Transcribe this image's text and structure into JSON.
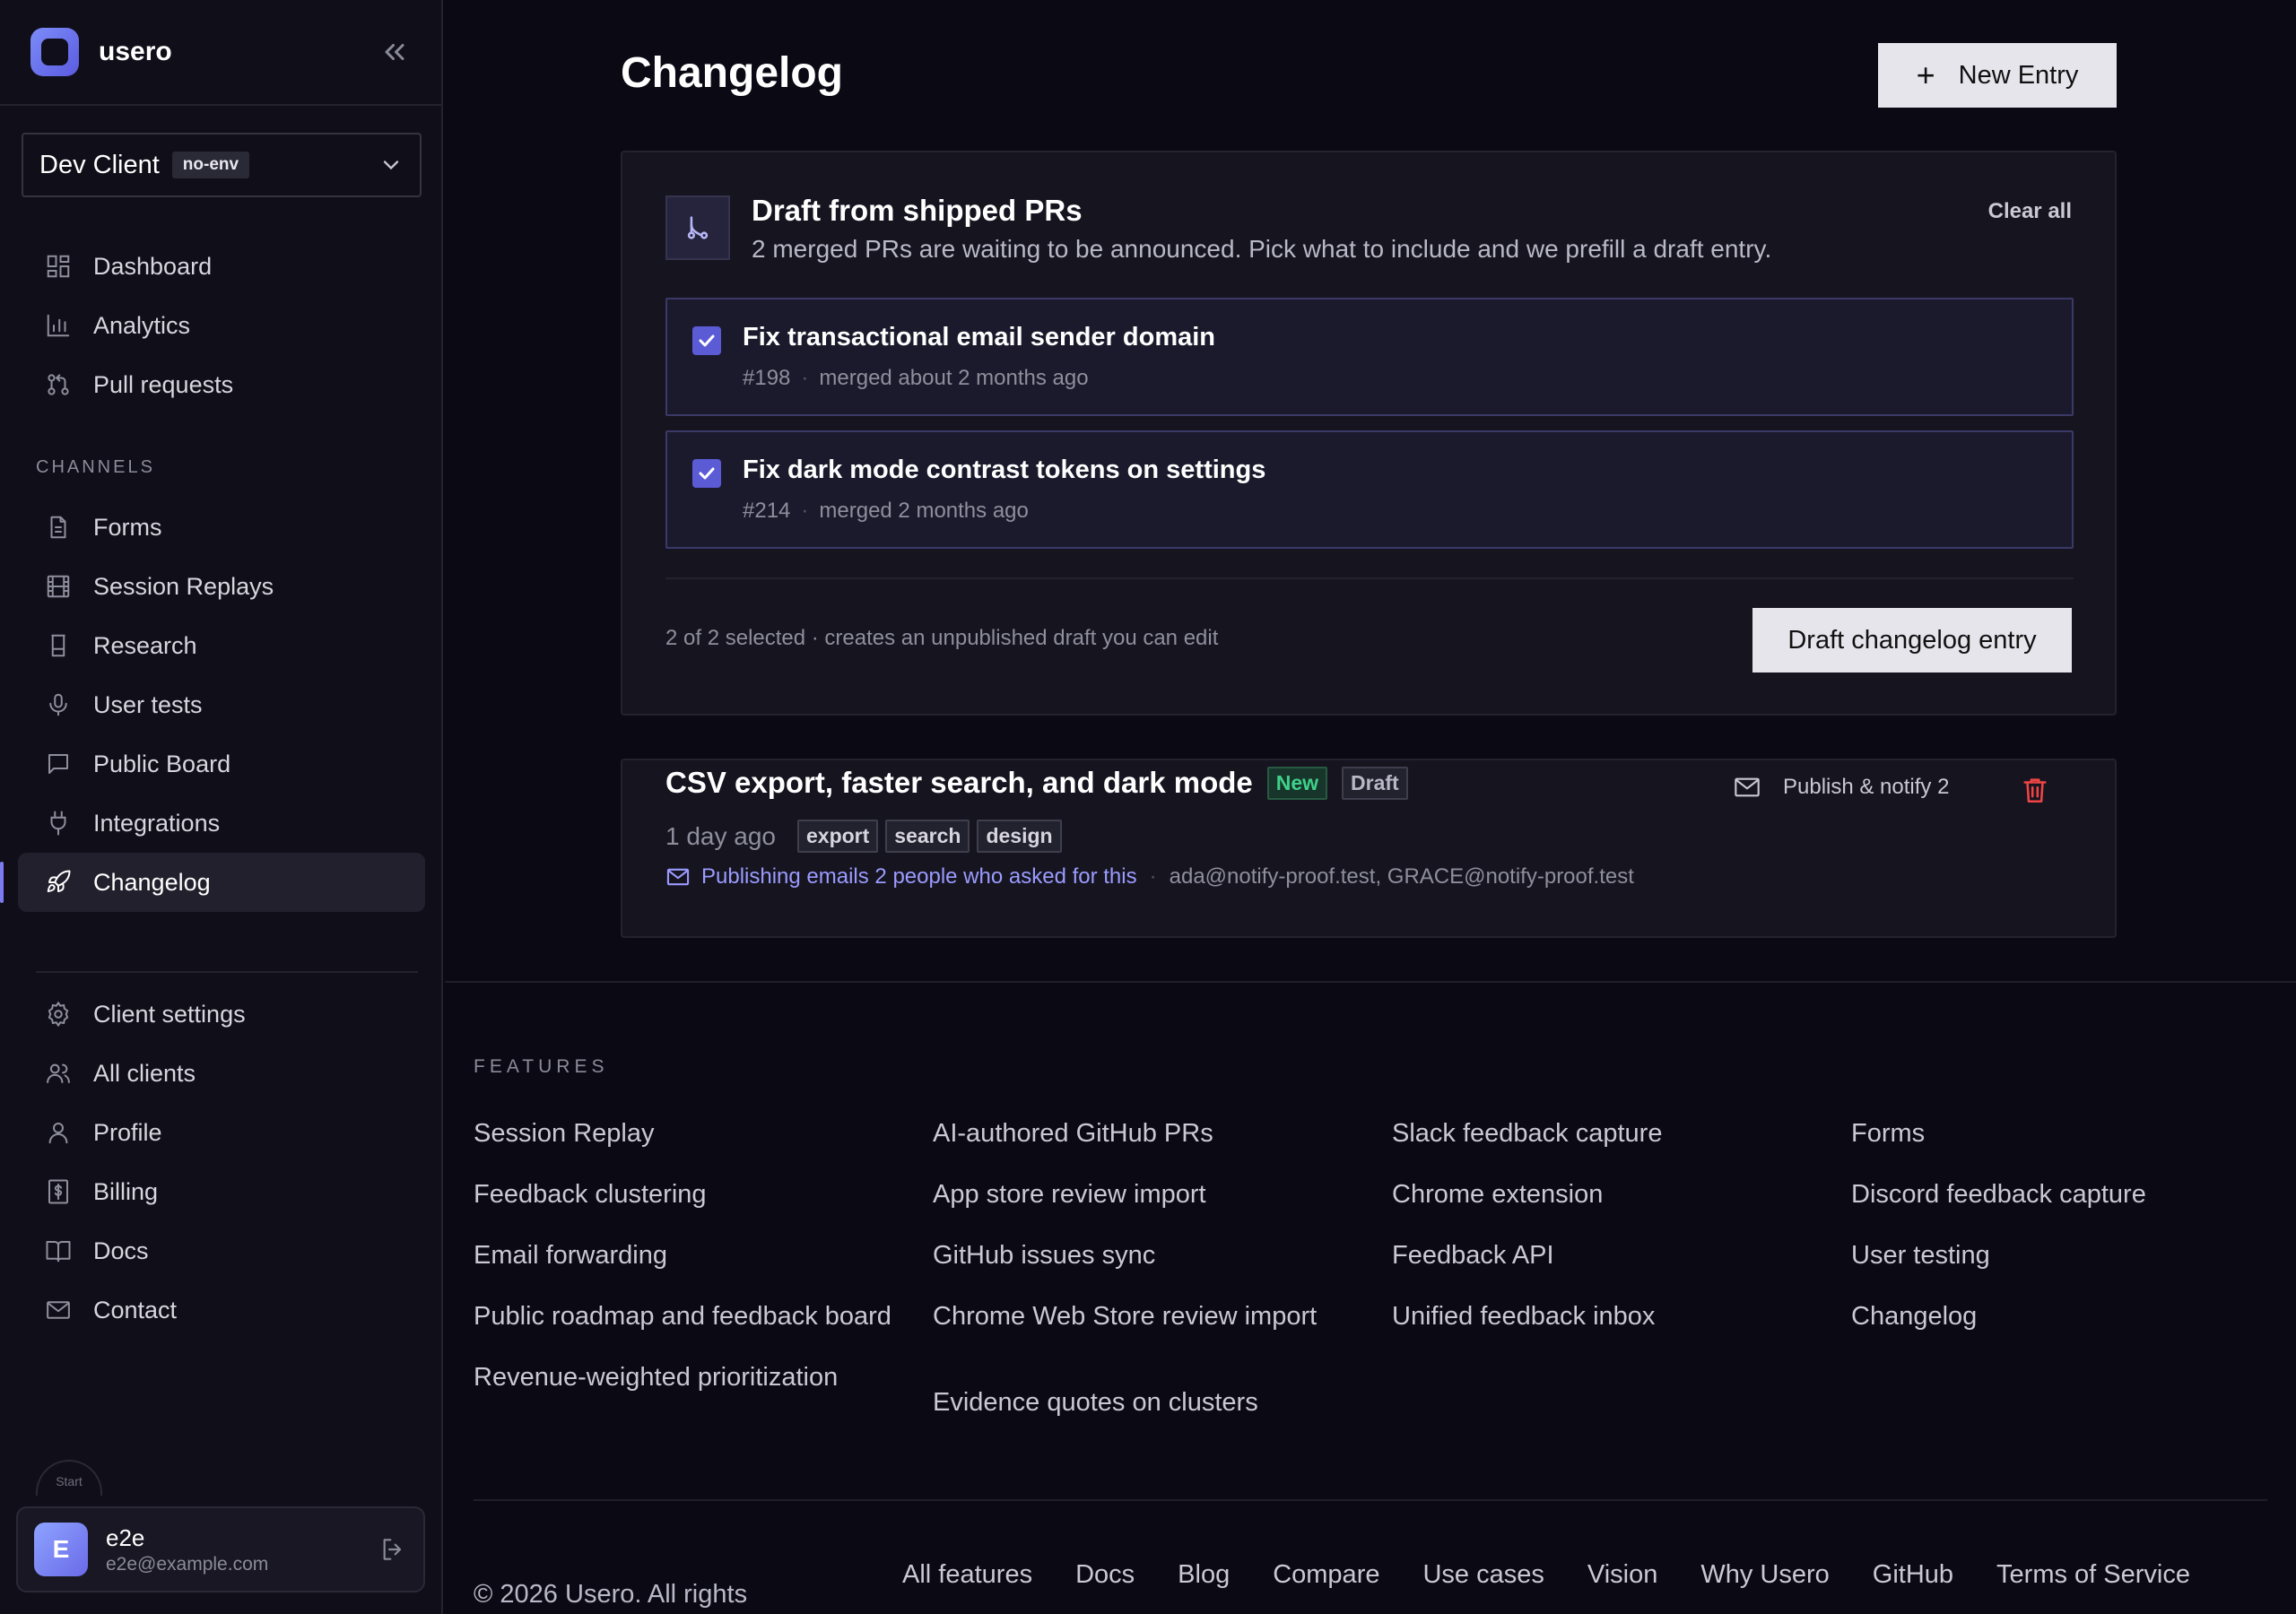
{
  "brand": {
    "name": "usero"
  },
  "client": {
    "name": "Dev Client",
    "env": "no-env"
  },
  "nav": {
    "primary": [
      {
        "label": "Dashboard",
        "icon": "dashboard-icon"
      },
      {
        "label": "Analytics",
        "icon": "bar-chart-icon"
      },
      {
        "label": "Pull requests",
        "icon": "pull-request-icon"
      }
    ],
    "channels_label": "CHANNELS",
    "channels": [
      {
        "label": "Forms",
        "icon": "document-icon"
      },
      {
        "label": "Session Replays",
        "icon": "film-icon"
      },
      {
        "label": "Research",
        "icon": "flask-icon"
      },
      {
        "label": "User tests",
        "icon": "microphone-icon"
      },
      {
        "label": "Public Board",
        "icon": "message-square-icon"
      },
      {
        "label": "Integrations",
        "icon": "plug-icon"
      },
      {
        "label": "Changelog",
        "icon": "rocket-icon",
        "active": true
      }
    ],
    "secondary": [
      {
        "label": "Client settings",
        "icon": "gear-icon"
      },
      {
        "label": "All clients",
        "icon": "users-icon"
      },
      {
        "label": "Profile",
        "icon": "user-icon"
      },
      {
        "label": "Billing",
        "icon": "billing-icon"
      },
      {
        "label": "Docs",
        "icon": "book-icon"
      },
      {
        "label": "Contact",
        "icon": "mail-icon"
      }
    ]
  },
  "start_chip": "Start",
  "user": {
    "initial": "E",
    "name": "e2e",
    "email": "e2e@example.com"
  },
  "page": {
    "title": "Changelog",
    "new_entry_label": "New Entry"
  },
  "draft_panel": {
    "title": "Draft from shipped PRs",
    "subtitle": "2 merged PRs are waiting to be announced. Pick what to include and we prefill a draft entry.",
    "clear_all": "Clear all",
    "prs": [
      {
        "title": "Fix transactional email sender domain",
        "number": "#198",
        "merged": "merged about 2 months ago",
        "checked": true
      },
      {
        "title": "Fix dark mode contrast tokens on settings",
        "number": "#214",
        "merged": "merged 2 months ago",
        "checked": true
      }
    ],
    "selected_text": "2 of 2 selected · creates an unpublished draft you can edit",
    "draft_button": "Draft changelog entry"
  },
  "entry": {
    "title": "CSV export, faster search, and dark mode",
    "badge_new": "New",
    "badge_draft": "Draft",
    "time": "1 day ago",
    "tags": [
      "export",
      "search",
      "design"
    ],
    "emails_text": "Publishing emails 2 people who asked for this",
    "emails_list": "ada@notify-proof.test, GRACE@notify-proof.test",
    "publish_label": "Publish & notify 2"
  },
  "footer": {
    "features_label": "FEATURES",
    "columns": [
      [
        "Session Replay",
        "Feedback clustering",
        "Email forwarding",
        "Public roadmap and feedback board",
        "Revenue-weighted prioritization"
      ],
      [
        "AI-authored GitHub PRs",
        "App store review import",
        "GitHub issues sync",
        "Chrome Web Store review import",
        "Evidence quotes on clusters"
      ],
      [
        "Slack feedback capture",
        "Chrome extension",
        "Feedback API",
        "Unified feedback inbox"
      ],
      [
        "Forms",
        "Discord feedback capture",
        "User testing",
        "Changelog"
      ]
    ],
    "copyright": "© 2026 Usero. All rights",
    "links": [
      "All features",
      "Docs",
      "Blog",
      "Compare",
      "Use cases",
      "Vision",
      "Why Usero",
      "GitHub",
      "Terms of Service"
    ]
  },
  "colors": {
    "accent": "#5b5bd6",
    "background": "#0b0a14",
    "sidebar": "#100f19",
    "success": "#3fd18a",
    "danger": "#ef4444"
  }
}
